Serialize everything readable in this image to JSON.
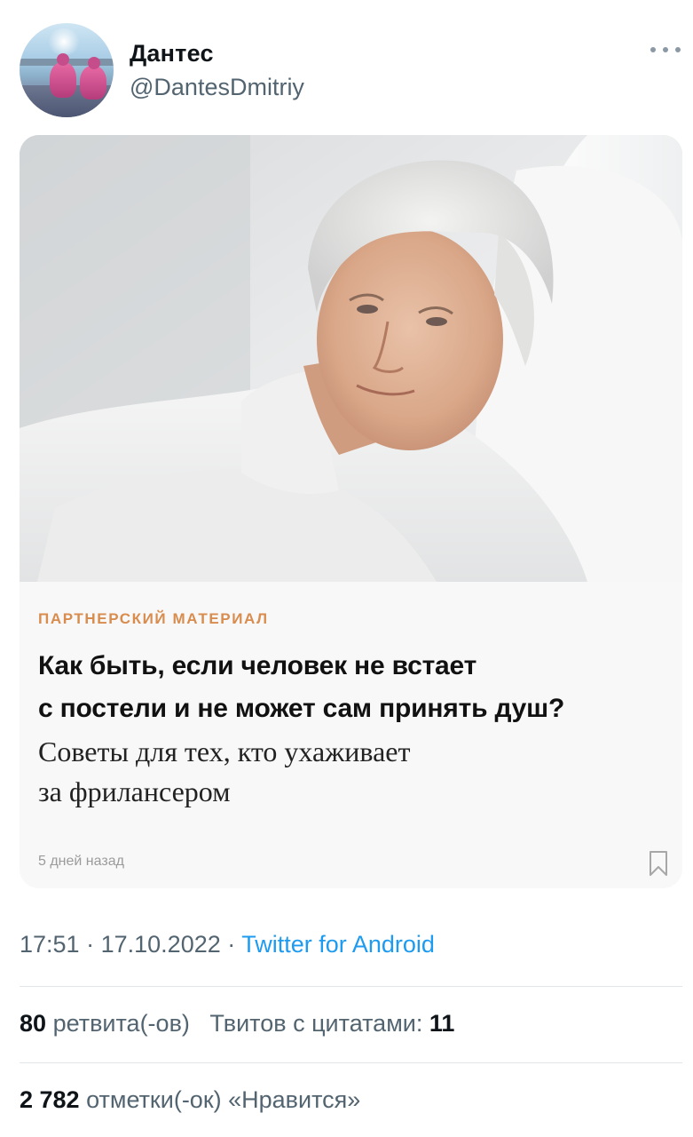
{
  "author": {
    "name": "Дантес",
    "handle": "@DantesDmitriy"
  },
  "card": {
    "label": "ПАРТНЕРСКИЙ МАТЕРИАЛ",
    "headline_line1": "Как быть, если человек не встает",
    "headline_line2": "с постели и не может сам принять душ?",
    "subline_line1": "Советы для тех, кто ухаживает",
    "subline_line2": "за фрилансером",
    "posted_ago": "5 дней назад"
  },
  "meta": {
    "time": "17:51",
    "separator": "·",
    "date": "17.10.2022",
    "source": "Twitter for Android"
  },
  "stats": {
    "retweets_count": "80",
    "retweets_label": "ретвита(-ов)",
    "quotes_label": "Твитов с цитатами:",
    "quotes_count": "11",
    "likes_count": "2 782",
    "likes_label": "отметки(-ок) «Нравится»"
  },
  "colors": {
    "accent_link": "#1d9bf0",
    "partner_label": "#d88c4e",
    "secondary_text": "#536471"
  },
  "icons": [
    "more-icon",
    "bookmark-icon"
  ]
}
